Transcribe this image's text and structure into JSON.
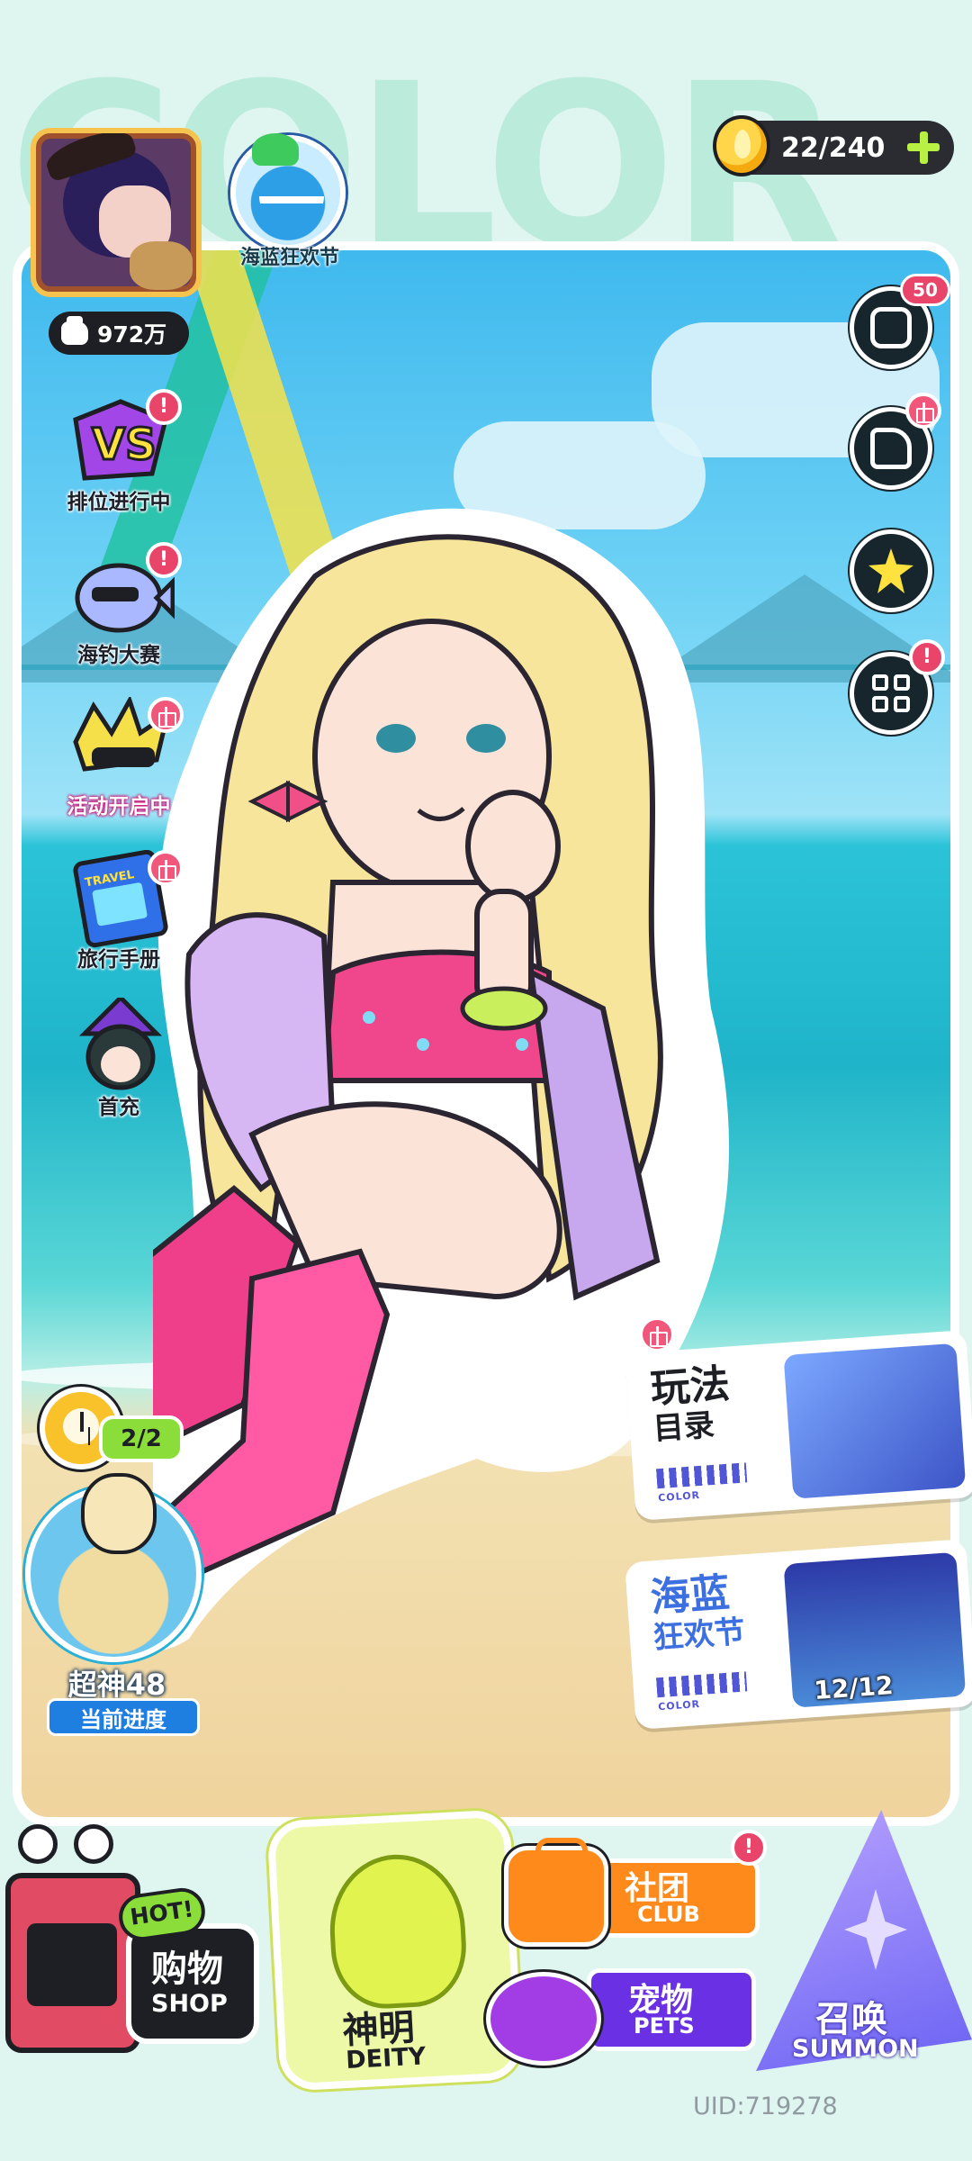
{
  "backdrop": {
    "wordmark": "COLOR"
  },
  "player": {
    "power": "972万"
  },
  "event": {
    "label": "海蓝狂欢节"
  },
  "currency": {
    "value": "22/240"
  },
  "left_activities": [
    {
      "id": "ranked",
      "label": "排位进行中",
      "badge": "!"
    },
    {
      "id": "fishing",
      "label": "海钓大赛",
      "badge": "!"
    },
    {
      "id": "events",
      "label": "活动开启中",
      "badge": "gift"
    },
    {
      "id": "travel",
      "label": "旅行手册",
      "badge": "gift",
      "art_text": "TRAVEL"
    },
    {
      "id": "first_recharge",
      "label": "首充",
      "badge": ""
    }
  ],
  "right_buttons": {
    "mail_count": "50"
  },
  "progress": {
    "clock_count": "2/2",
    "title": "超神48",
    "subtitle": "当前进度"
  },
  "cards": [
    {
      "id": "modes",
      "title_line1": "玩法",
      "title_line2": "目录",
      "brand": "COLOR"
    },
    {
      "id": "ocean_fest",
      "title_line1": "海蓝",
      "title_line2": "狂欢节",
      "brand": "COLOR",
      "counter": "12/12"
    }
  ],
  "bottom_menu": {
    "shop": {
      "hot": "HOT!",
      "zh": "购物",
      "en": "SHOP"
    },
    "deity": {
      "zh": "神明",
      "en": "DEITY"
    },
    "club": {
      "zh": "社团",
      "en": "CLUB"
    },
    "pets": {
      "zh": "宠物",
      "en": "PETS"
    },
    "summon": {
      "zh": "召唤",
      "en": "SUMMON"
    }
  },
  "footer": {
    "uid": "UID:719278"
  },
  "colors": {
    "alert": "#e9456a",
    "currency_plus": "#b8f044",
    "hot_tag": "#8bde39",
    "club": "#ff8a1c",
    "pets": "#6a30e3",
    "summon": "#6a62f3"
  }
}
